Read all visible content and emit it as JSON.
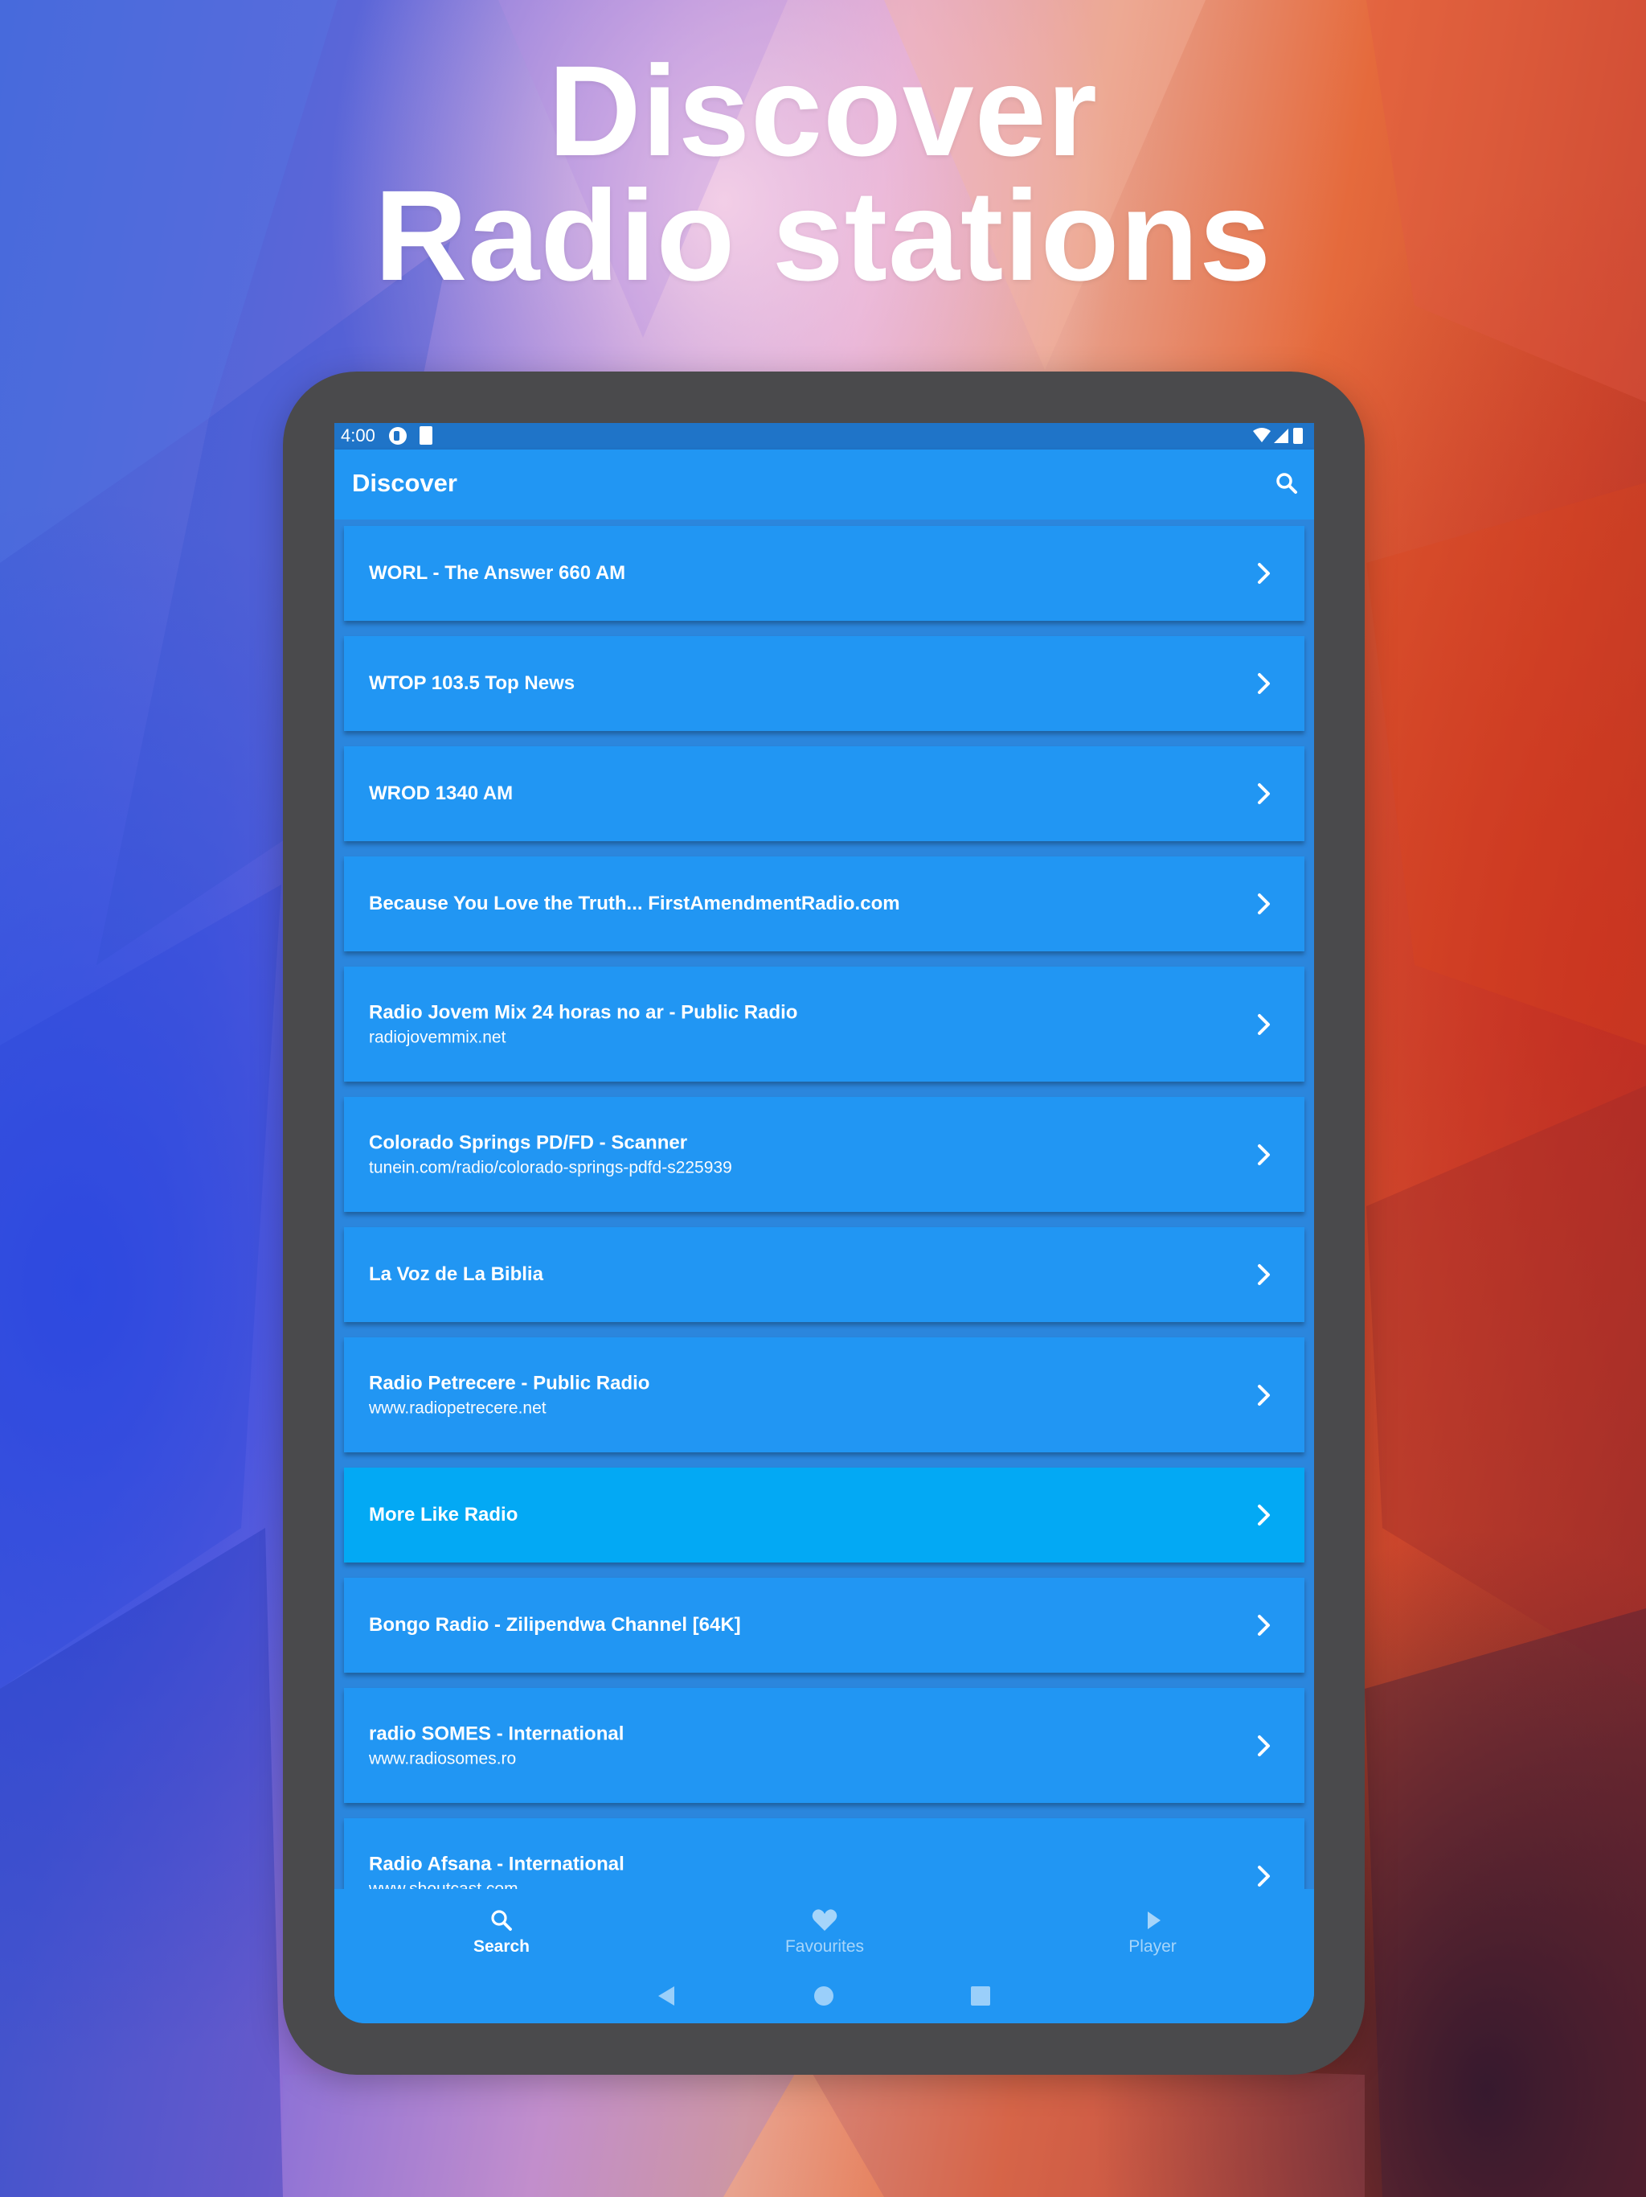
{
  "headline": {
    "line1": "Discover",
    "line2": "Radio stations"
  },
  "status_bar": {
    "time": "4:00"
  },
  "app_bar": {
    "title": "Discover",
    "search_icon": "search-icon"
  },
  "stations": [
    {
      "title": "WORL - The Answer 660 AM",
      "subtitle": ""
    },
    {
      "title": "WTOP 103.5 Top News",
      "subtitle": ""
    },
    {
      "title": "WROD 1340 AM",
      "subtitle": ""
    },
    {
      "title": "Because You Love the Truth... FirstAmendmentRadio.com",
      "subtitle": ""
    },
    {
      "title": "Radio Jovem Mix 24 horas no ar - Public Radio",
      "subtitle": "radiojovemmix.net"
    },
    {
      "title": "Colorado Springs PD/FD - Scanner",
      "subtitle": "tunein.com/radio/colorado-springs-pdfd-s225939"
    },
    {
      "title": "La Voz de La Biblia",
      "subtitle": ""
    },
    {
      "title": "Radio Petrecere - Public Radio",
      "subtitle": "www.radiopetrecere.net"
    },
    {
      "title": "More Like Radio",
      "subtitle": "",
      "highlighted": true
    },
    {
      "title": "Bongo Radio - Zilipendwa Channel [64K]",
      "subtitle": ""
    },
    {
      "title": "radio SOMES - International",
      "subtitle": "www.radiosomes.ro"
    },
    {
      "title": "Radio Afsana - International",
      "subtitle": "www.shoutcast.com"
    }
  ],
  "bottom_nav": [
    {
      "label": "Search",
      "icon": "search-icon",
      "active": true
    },
    {
      "label": "Favourites",
      "icon": "heart-icon",
      "active": false
    },
    {
      "label": "Player",
      "icon": "play-icon",
      "active": false
    }
  ],
  "system_nav": [
    "back-icon",
    "home-icon",
    "recents-icon"
  ],
  "colors": {
    "app_bar": "#2196f3",
    "status_bar": "#1f74c8",
    "card": "#2196f3",
    "card_highlight": "#03a9f4",
    "tablet_frame": "#4a4a4c",
    "text": "#ffffff"
  }
}
